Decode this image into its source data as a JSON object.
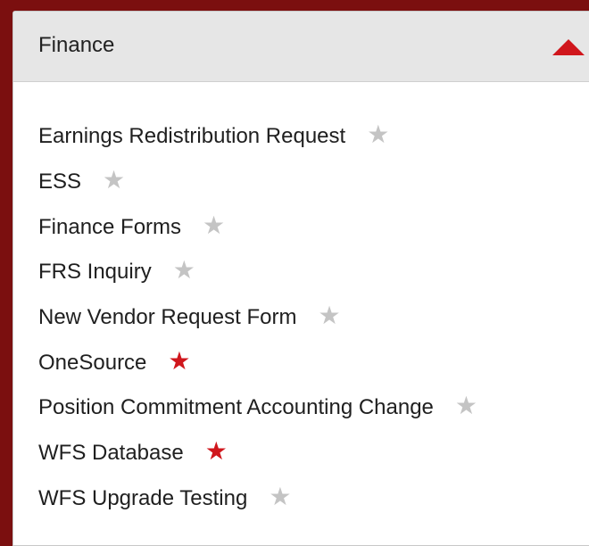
{
  "panel": {
    "title": "Finance",
    "collapse_icon": "triangle-up-icon",
    "accent_color": "#d0161c",
    "background_color": "#7b0f0f"
  },
  "links": [
    {
      "label": "Earnings Redistribution Request",
      "favorite": false
    },
    {
      "label": "ESS",
      "favorite": false
    },
    {
      "label": "Finance Forms",
      "favorite": false
    },
    {
      "label": "FRS Inquiry",
      "favorite": false
    },
    {
      "label": "New Vendor Request Form",
      "favorite": false
    },
    {
      "label": "OneSource",
      "favorite": true
    },
    {
      "label": "Position Commitment Accounting Change",
      "favorite": false
    },
    {
      "label": "WFS Database",
      "favorite": true
    },
    {
      "label": "WFS Upgrade Testing",
      "favorite": false
    }
  ],
  "star_glyph": "★"
}
